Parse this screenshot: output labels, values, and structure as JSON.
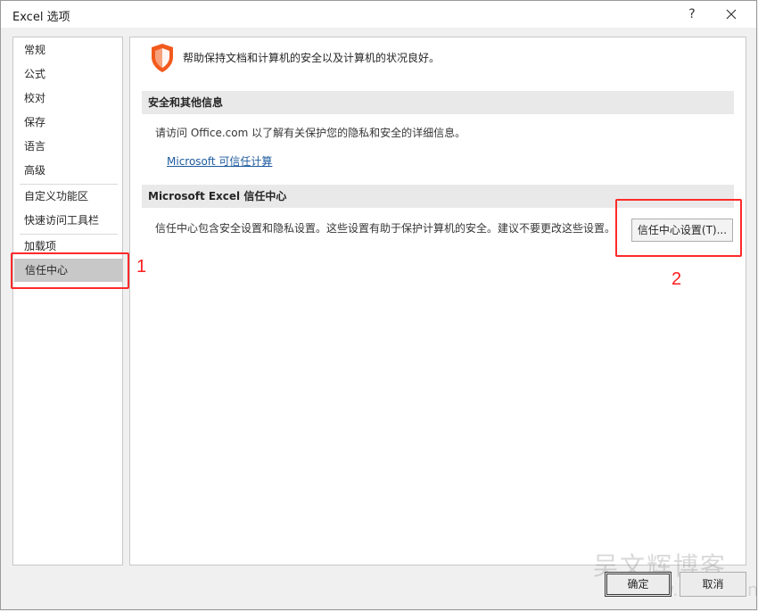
{
  "window": {
    "title": "Excel 选项",
    "help": "?"
  },
  "sidebar": {
    "items": [
      {
        "label": "常规"
      },
      {
        "label": "公式"
      },
      {
        "label": "校对"
      },
      {
        "label": "保存"
      },
      {
        "label": "语言"
      },
      {
        "label": "高级"
      },
      {
        "label": "自定义功能区"
      },
      {
        "label": "快速访问工具栏"
      },
      {
        "label": "加载项"
      },
      {
        "label": "信任中心",
        "selected": true
      }
    ]
  },
  "main": {
    "header": "帮助保持文档和计算机的安全以及计算机的状况良好。",
    "section1": {
      "title": "安全和其他信息",
      "text": "请访问 Office.com 以了解有关保护您的隐私和安全的详细信息。",
      "link": "Microsoft 可信任计算"
    },
    "section2": {
      "title": "Microsoft Excel 信任中心",
      "text": "信任中心包含安全设置和隐私设置。这些设置有助于保护计算机的安全。建议不要更改这些设置。",
      "button": "信任中心设置(T)..."
    }
  },
  "annotations": {
    "one": "1",
    "two": "2",
    "color": "#ff2a2a"
  },
  "footer": {
    "ok": "确定",
    "cancel": "取消"
  },
  "watermark": {
    "text": "吴文辉博客",
    "url": "www.wnhui.cn"
  },
  "colors": {
    "shield": "#f25a1d",
    "link": "#1d5a9e",
    "selected": "#c8c8c8"
  }
}
